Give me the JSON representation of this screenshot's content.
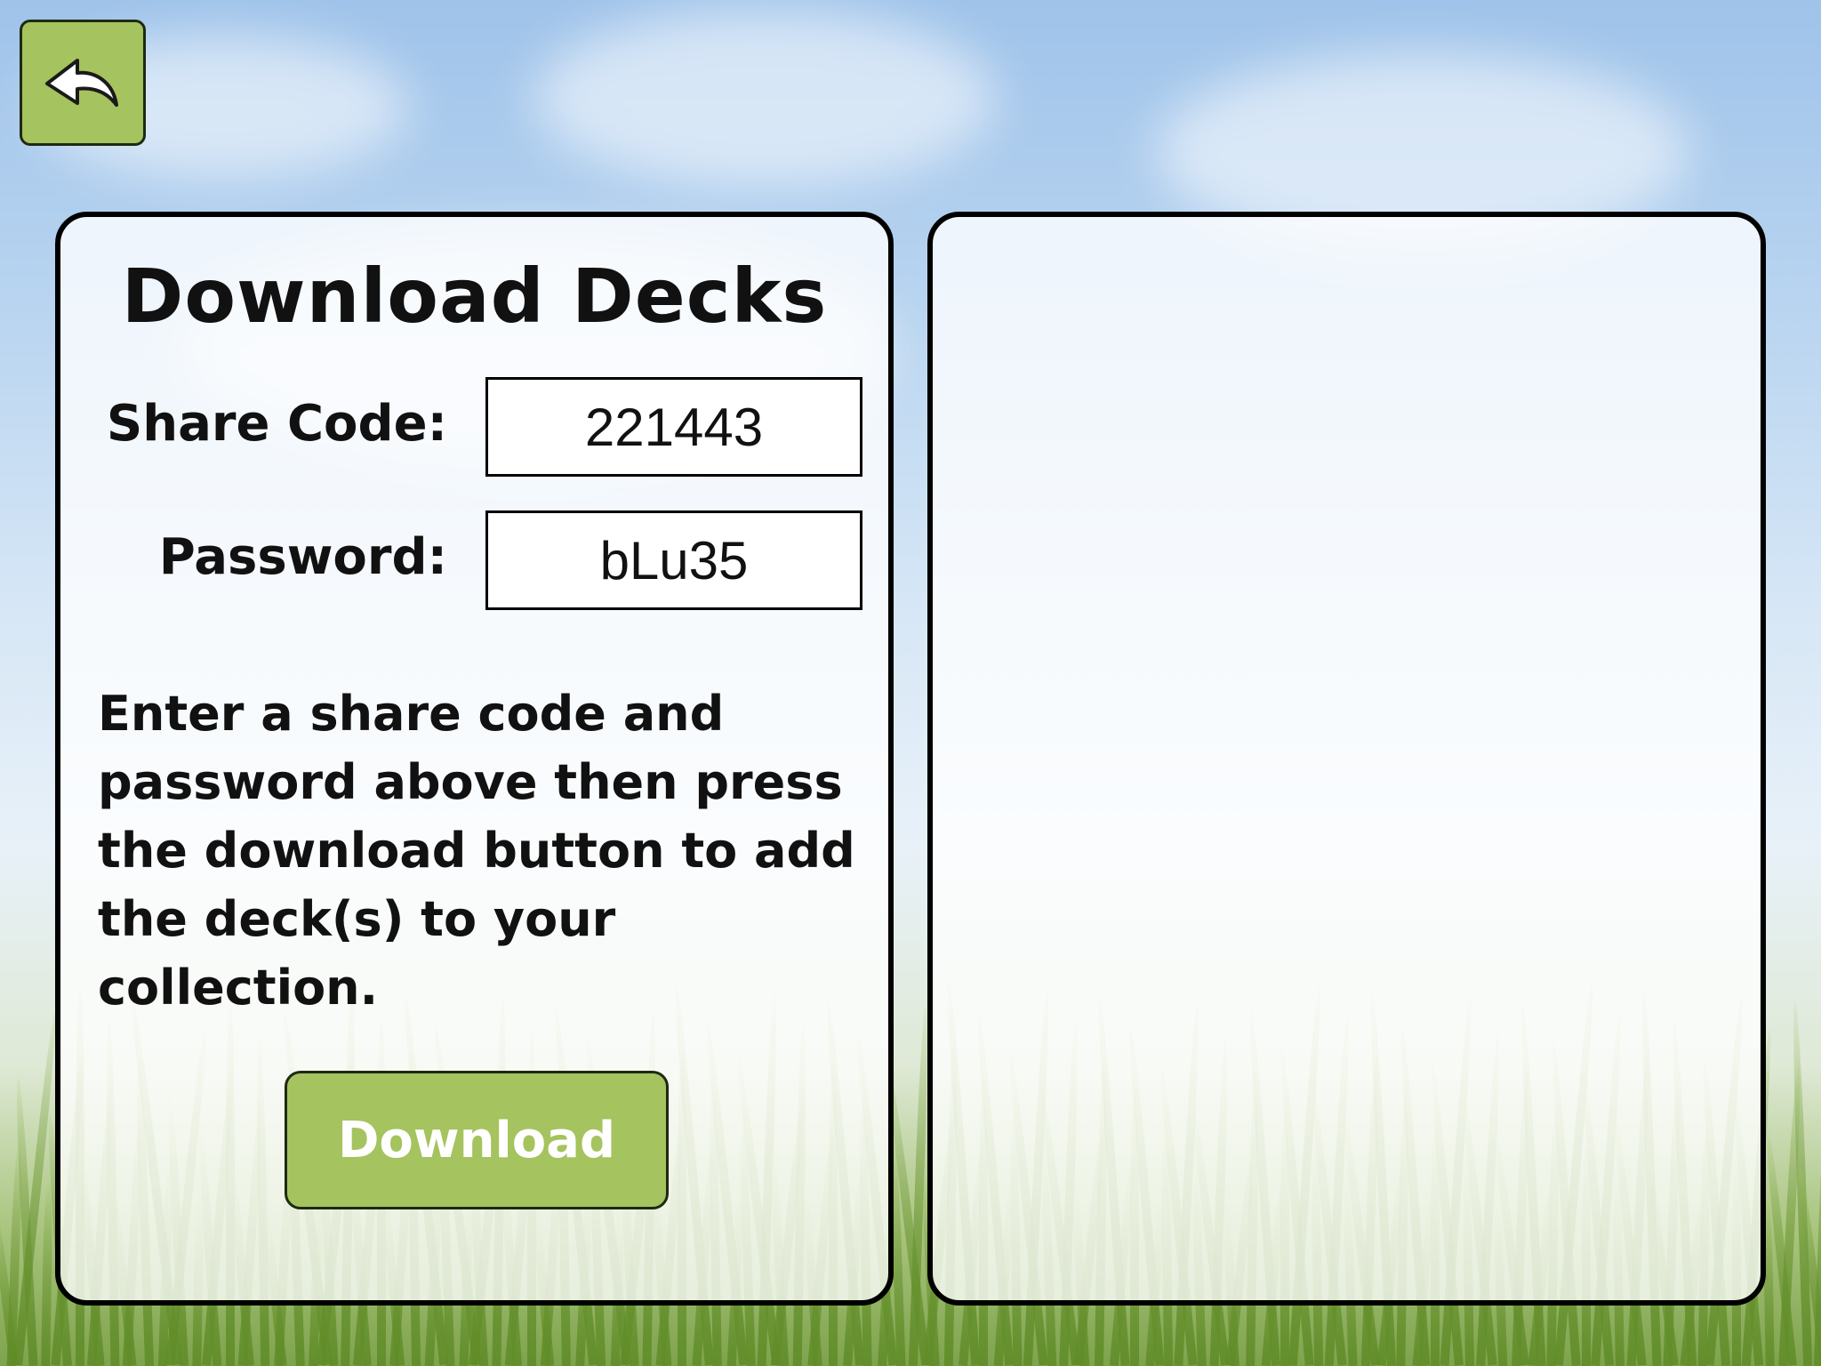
{
  "screen": {
    "title": "Download Decks",
    "share_code": {
      "label": "Share Code:",
      "value": "221443"
    },
    "password": {
      "label": "Password:",
      "value": "bLu35"
    },
    "instructions": "Enter a share code and password above then press the download button to add the deck(s) to your collection.",
    "download_label": "Download"
  },
  "icons": {
    "back": "undo-arrow-icon"
  },
  "colors": {
    "accent_green": "#a5c35e",
    "panel_border": "#000000",
    "sky": "#9fc3ea"
  }
}
